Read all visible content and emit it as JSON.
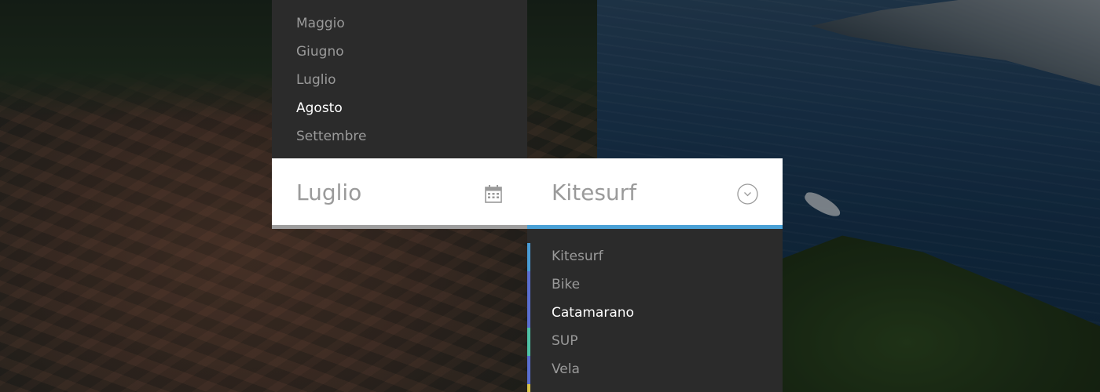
{
  "months": {
    "items": [
      {
        "label": "Maggio",
        "active": false
      },
      {
        "label": "Giugno",
        "active": false
      },
      {
        "label": "Luglio",
        "active": false
      },
      {
        "label": "Agosto",
        "active": true
      },
      {
        "label": "Settembre",
        "active": false
      }
    ]
  },
  "form": {
    "month_value": "Luglio",
    "activity_value": "Kitesurf",
    "month_icon": "calendar-icon",
    "activity_icon": "chevron-down-circle-icon"
  },
  "activities": {
    "items": [
      {
        "label": "Kitesurf",
        "active": false,
        "accent": "#4a9cd6"
      },
      {
        "label": "Bike",
        "active": false,
        "accent": "#5a6fd0"
      },
      {
        "label": "Catamarano",
        "active": true,
        "accent": "#5a6fd0"
      },
      {
        "label": "SUP",
        "active": false,
        "accent": "#4fc2a6"
      },
      {
        "label": "Vela",
        "active": false,
        "accent": "#5a6fd0"
      },
      {
        "label": "",
        "active": false,
        "accent": "#d8c24a"
      }
    ]
  },
  "colors": {
    "panel_bg": "#2b2b2b",
    "item_text": "#9a9a9a",
    "item_active": "#ffffff",
    "activity_underline": "#4aa1d6",
    "month_underline": "#9e9e9e"
  }
}
